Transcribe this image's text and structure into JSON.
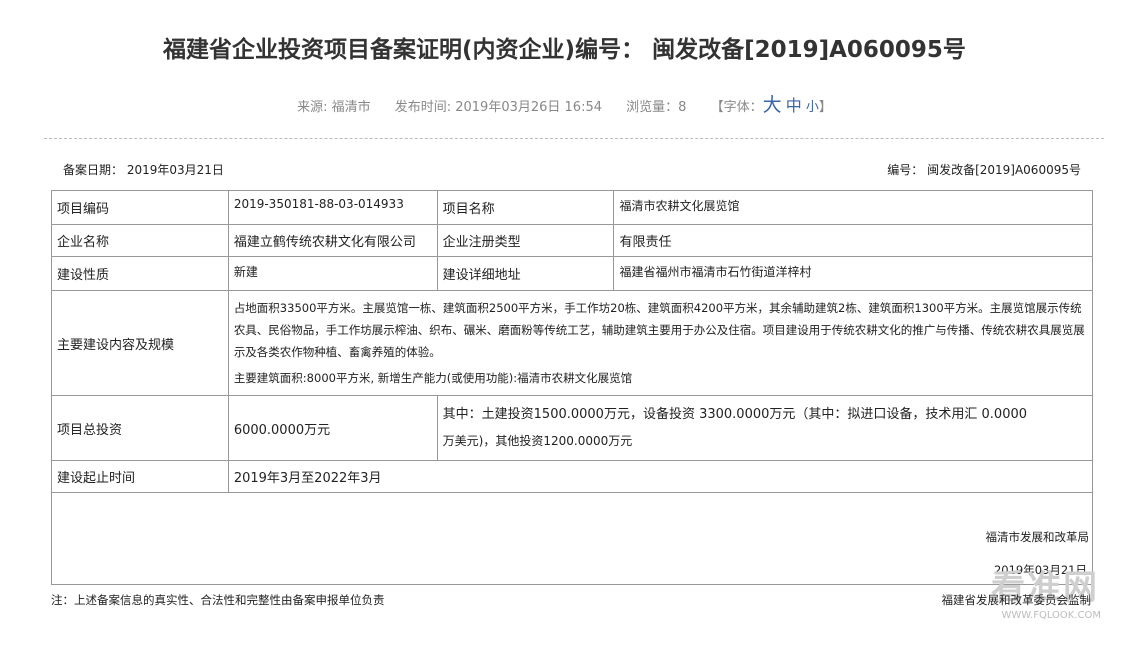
{
  "header": {
    "title": "福建省企业投资项目备案证明(内资企业)编号： 闽发改备[2019]A060095号",
    "source": "来源: 福清市",
    "published": "发布时间: 2019年03月26日 16:54",
    "views": "浏览量：8",
    "font_prefix": "【字体：",
    "font_big": "大",
    "font_mid": "中",
    "font_small": "小",
    "font_suffix": "】"
  },
  "record": {
    "date": "备案日期： 2019年03月21日",
    "number": "编号： 闽发改备[2019]A060095号"
  },
  "table": {
    "code_label": "项目编码",
    "code_value": "2019-350181-88-03-014933",
    "name_label": "项目名称",
    "name_value": "福清市农耕文化展览馆",
    "company_label": "企业名称",
    "company_value": "福建立鹤传统农耕文化有限公司",
    "type_label": "企业注册类型",
    "type_value": "有限责任",
    "nature_label": "建设性质",
    "nature_value": "新建",
    "address_label": "建设详细地址",
    "address_value": "福建省福州市福清市石竹街道洋梓村",
    "content_label": "主要建设内容及规模",
    "content_value": "占地面积33500平方米。主展览馆一栋、建筑面积2500平方米，手工作坊20栋、建筑面积4200平方米，其余辅助建筑2栋、建筑面积1300平方米。主展览馆展示传统农具、民俗物品，手工作坊展示榨油、织布、碾米、磨面粉等传统工艺，辅助建筑主要用于办公及住宿。项目建设用于传统农耕文化的推广与传播、传统农耕农具展览展示及各类农作物种植、畜禽养殖的体验。",
    "content_sub": "主要建筑面积:8000平方米, 新增生产能力(或使用功能):福清市农耕文化展览馆",
    "invest_label": "项目总投资",
    "invest_value": "6000.0000万元",
    "invest_detail_1": "其中：土建投资1500.0000万元，设备投资 3300.0000万元（其中：拟进口设备，技术用汇 0.0000",
    "invest_detail_2": "万美元)，其他投资1200.0000万元",
    "period_label": "建设起止时间",
    "period_value": "2019年3月至2022年3月"
  },
  "signature": {
    "org": "福清市发展和改革局",
    "date": "2019年03月21日"
  },
  "footer": {
    "note": "注：上述备案信息的真实性、合法性和完整性由备案申报单位负责",
    "supervisor": "福建省发展和改革委员会监制"
  },
  "watermark": {
    "text": "看准网",
    "url": "WWW.FQLOOK.COM"
  }
}
